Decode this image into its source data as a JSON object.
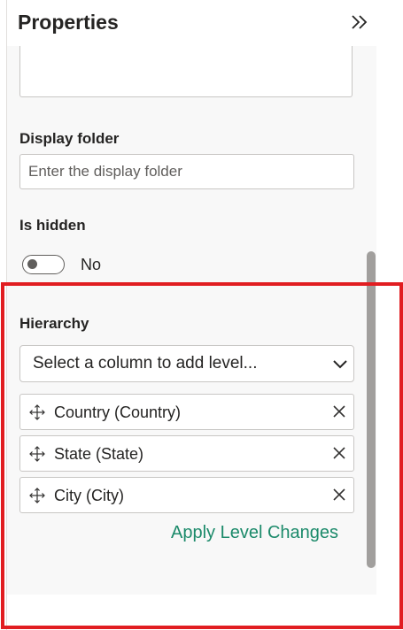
{
  "panel": {
    "title": "Properties",
    "collapse_icon": "double-chevron-right-icon"
  },
  "display_folder": {
    "label": "Display folder",
    "placeholder": "Enter the display folder",
    "value": ""
  },
  "is_hidden": {
    "label": "Is hidden",
    "state_text": "No",
    "checked": false
  },
  "hierarchy": {
    "label": "Hierarchy",
    "select_placeholder": "Select a column to add level...",
    "levels": [
      {
        "label": "Country (Country)",
        "drag_icon": "move-icon",
        "remove_icon": "close-icon"
      },
      {
        "label": "State (State)",
        "drag_icon": "move-icon",
        "remove_icon": "close-icon"
      },
      {
        "label": "City (City)",
        "drag_icon": "move-icon",
        "remove_icon": "close-icon"
      }
    ],
    "apply_label": "Apply Level Changes"
  },
  "colors": {
    "accent_link": "#1b8a6a",
    "highlight_border": "#e11d21",
    "panel_bg": "#f8f8f8"
  }
}
